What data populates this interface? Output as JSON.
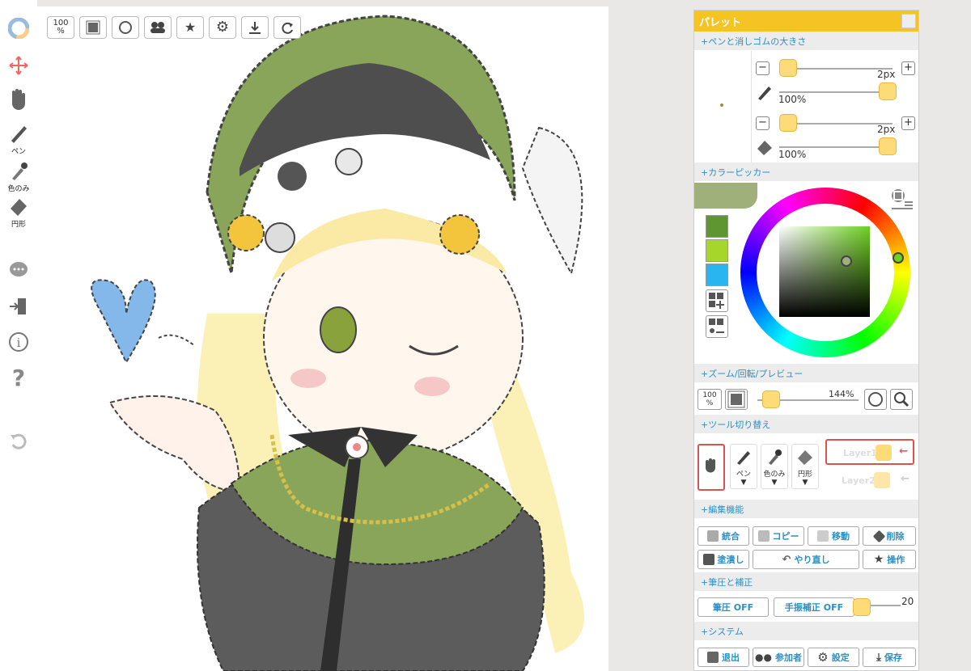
{
  "toolbar": {
    "zoom": "100",
    "zoom_pct": "%"
  },
  "left": {
    "pen": "ペン",
    "color_only": "色のみ",
    "circle": "円形"
  },
  "panel": {
    "title": "パレット",
    "sec_pen": "+ペンと消しゴムの大きさ",
    "pen_size": "2px",
    "pen_opacity": "100%",
    "eraser_size": "2px",
    "eraser_opacity": "100%",
    "sec_color": "+カラーピッカー",
    "sec_zoom": "+ズーム/回転/プレビュー",
    "zoom_btn": "100",
    "zoom_pct_lbl": "%",
    "zoom_value": "144%",
    "sec_tools": "+ツール切り替え",
    "tool_pen": "ペン",
    "tool_color": "色のみ",
    "tool_circle": "円形",
    "arrow": "▼",
    "layer1": "Layer1",
    "layer2": "Layer2",
    "sec_edit": "+編集機能",
    "merge": "統合",
    "copy": "コピー",
    "move": "移動",
    "delete": "削除",
    "fill": "塗潰し",
    "redo": "やり直し",
    "ops": "操作",
    "sec_pressure": "+筆圧と補正",
    "pressure": "筆圧 OFF",
    "stabilizer": "手振補正 OFF",
    "stab_value": "20",
    "sec_system": "+システム",
    "exit": "退出",
    "participants": "参加者",
    "settings": "設定",
    "save": "保存"
  },
  "colors": {
    "current": "#a0b07a",
    "swatches": [
      "#5f9632",
      "#a7d62a",
      "#29b6f0"
    ]
  }
}
